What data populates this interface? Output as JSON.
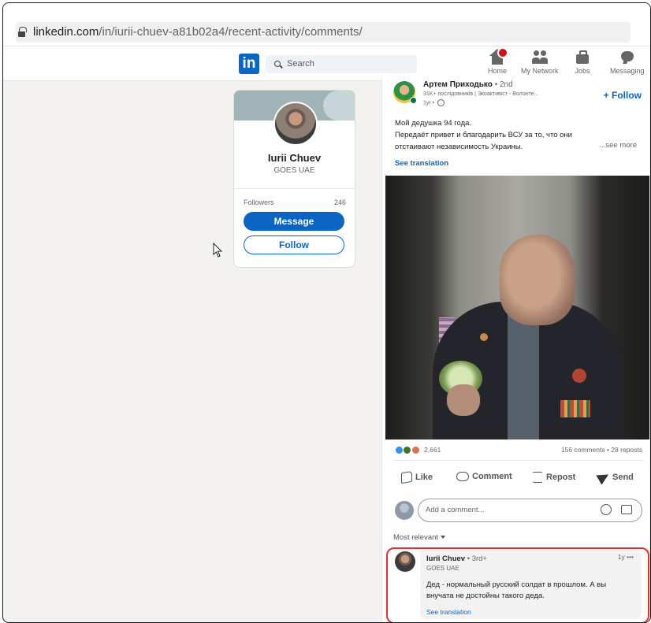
{
  "browser": {
    "url_host": "linkedin.com",
    "url_path": "/in/iurii-chuev-a81b02a4/recent-activity/comments/"
  },
  "nav": {
    "logo": "in",
    "search_placeholder": "Search",
    "items": [
      {
        "label": "Home",
        "icon": "home-icon"
      },
      {
        "label": "My Network",
        "icon": "network-icon"
      },
      {
        "label": "Jobs",
        "icon": "jobs-icon"
      },
      {
        "label": "Messaging",
        "icon": "messaging-icon"
      }
    ]
  },
  "profile": {
    "name": "Iurii Chuev",
    "headline": "GOES UAE",
    "followers_label": "Followers",
    "followers_count": "246",
    "message_label": "Message",
    "follow_label": "Follow"
  },
  "post": {
    "author_name": "Артем Приходько",
    "author_degree": " • 2nd",
    "author_subtitle": "31K+ послідовників | Экоактивіст - Волонте...",
    "author_time": "1yr • ",
    "follow_label": "+ Follow",
    "text_lines": [
      "Мой дедушка 94 года.",
      "Передаёт привет и благодарить ВСУ за то, что они",
      "отстаивают независимость Украины."
    ],
    "see_more": "...see more",
    "see_translation": "See translation",
    "reaction_count": "2,661",
    "stats": "156 comments • 28 reposts",
    "actions": [
      "Like",
      "Comment",
      "Repost",
      "Send"
    ],
    "comment_placeholder": "Add a comment...",
    "sort_label": "Most relevant"
  },
  "comment": {
    "author_name": "Iurii Chuev",
    "author_degree": " • 3rd+",
    "headline": "GOES UAE",
    "time": "1y •••",
    "text": "Дед - нормальный русский солдат в прошлом. А вы внучата не достойны такого деда.",
    "see_translation": "See translation"
  },
  "colors": {
    "brand": "#0a66c2",
    "highlight": "#e0312f"
  }
}
